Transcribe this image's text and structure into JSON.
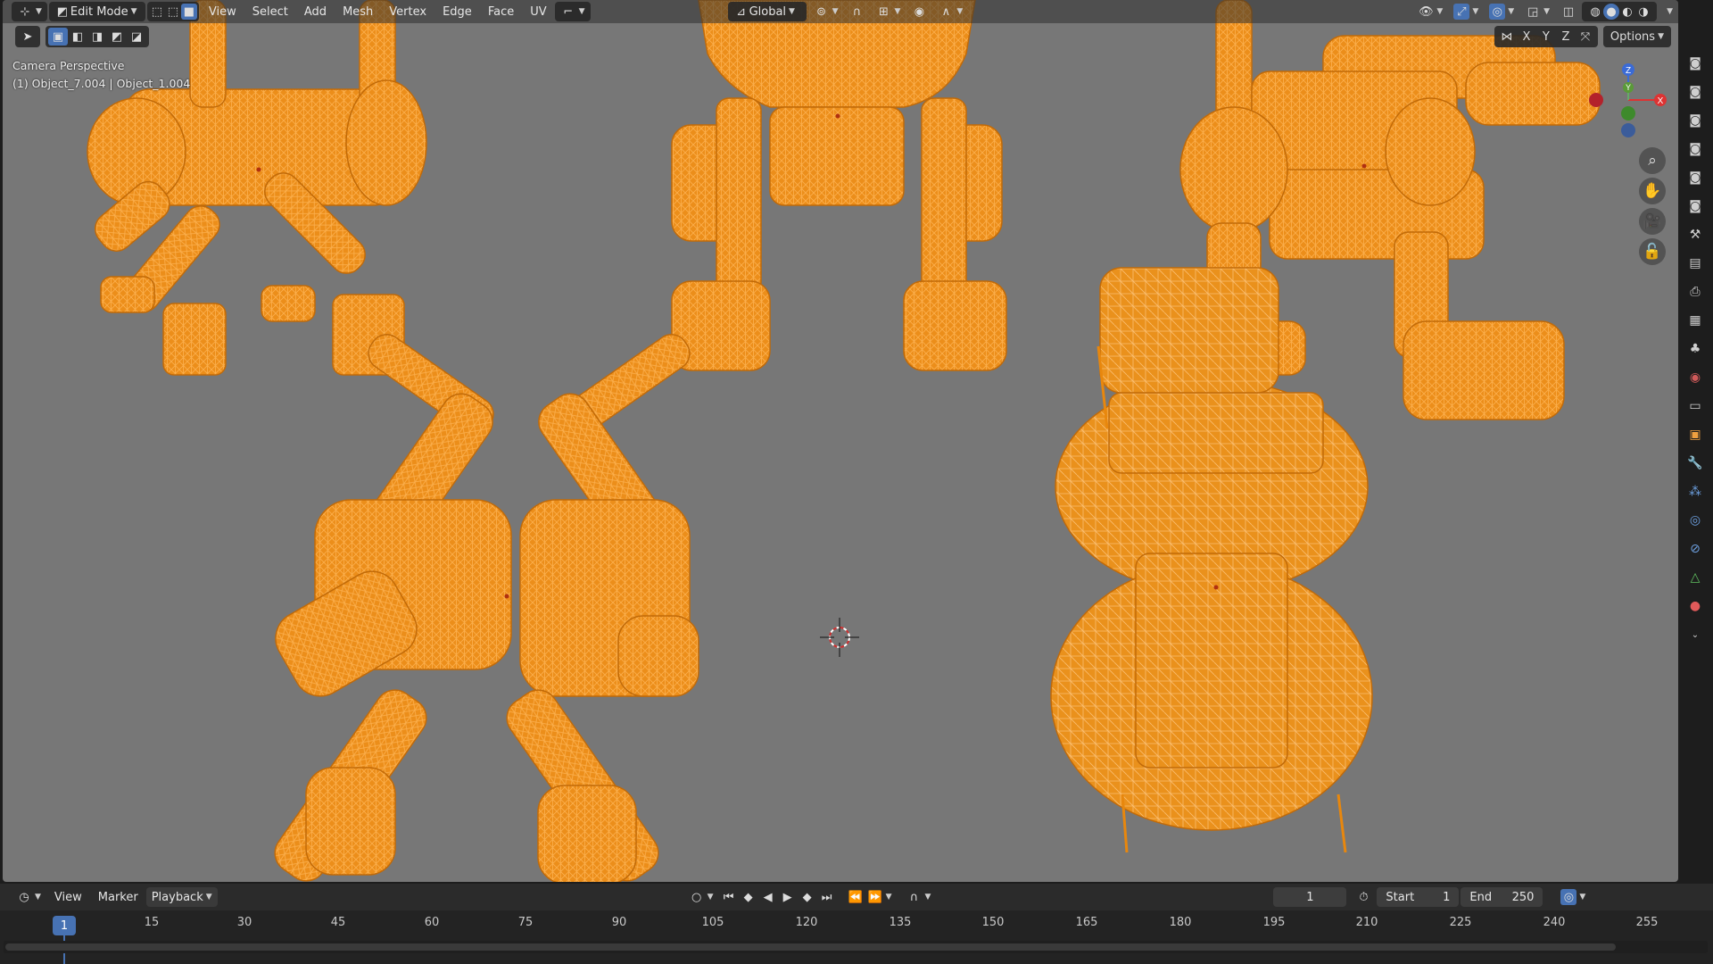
{
  "header": {
    "mode": "Edit Mode",
    "menus": [
      "View",
      "Select",
      "Add",
      "Mesh",
      "Vertex",
      "Edge",
      "Face",
      "UV"
    ],
    "transform_orientation": "Global",
    "options_label": "Options",
    "axis_x": "X",
    "axis_y": "Y",
    "axis_z": "Z"
  },
  "viewport": {
    "view_name": "Camera Perspective",
    "object_info": "(1) Object_7.004 | Object_1.004",
    "wire_color": "#ff9a1a",
    "background": "#777777",
    "gizmo": {
      "x": "X",
      "y": "Y",
      "z": "Z"
    }
  },
  "timeline": {
    "menus": [
      "View",
      "Marker",
      "Playback"
    ],
    "current_frame": "1",
    "start_label": "Start",
    "start_value": "1",
    "end_label": "End",
    "end_value": "250",
    "playhead": "1",
    "ticks": [
      "15",
      "30",
      "45",
      "60",
      "75",
      "90",
      "105",
      "120",
      "135",
      "150",
      "165",
      "180",
      "195",
      "210",
      "225",
      "240",
      "255"
    ]
  }
}
